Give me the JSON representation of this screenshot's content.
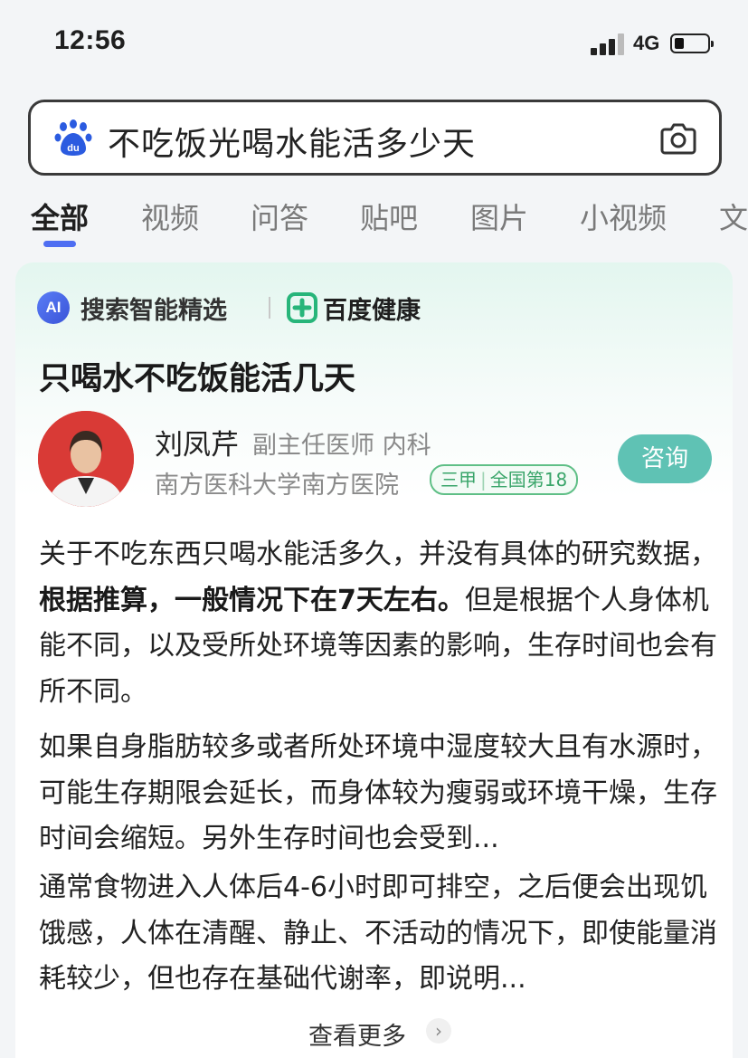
{
  "status_bar": {
    "time": "12:56",
    "network": "4G"
  },
  "search": {
    "query": "不吃饭光喝水能活多少天"
  },
  "tabs": [
    {
      "label": "全部",
      "active": true
    },
    {
      "label": "视频"
    },
    {
      "label": "问答"
    },
    {
      "label": "贴吧"
    },
    {
      "label": "图片"
    },
    {
      "label": "小视频"
    },
    {
      "label": "文"
    }
  ],
  "card": {
    "ai_badge": "AI",
    "ai_label": "搜索智能精选",
    "health_label": "百度健康",
    "title": "只喝水不吃饭能活几天",
    "doctor": {
      "name": "刘凤芹",
      "title": "副主任医师 内科",
      "hospital": "南方医科大学南方医院",
      "grade": "三甲",
      "rank": "全国第18",
      "consult_label": "咨询"
    },
    "paragraph1": {
      "before": "关于不吃东西只喝水能活多久，并没有具体的研究数据，",
      "bold": "根据推算，一般情况下在7天左右。",
      "after": "但是根据个人身体机能不同，以及受所处环境等因素的影响，生存时间也会有所不同。"
    },
    "paragraph2": "如果自身脂肪较多或者所处环境中湿度较大且有水源时，可能生存期限会延长，而身体较为瘦弱或环境干燥，生存时间会缩短。另外生存时间也会受到...",
    "paragraph3": "通常食物进入人体后4-6小时即可排空，之后便会出现饥饿感，人体在清醒、静止、不活动的情况下，即使能量消耗较少，但也存在基础代谢率，即说明...",
    "more_label": "查看更多"
  },
  "colors": {
    "accent": "#4e6ef2",
    "consult": "#5fc2b4",
    "badge_green": "#3aa56a",
    "avatar_bg": "#d93a36"
  },
  "icons": [
    "baidu-paw-icon",
    "camera-icon",
    "ai-badge-icon",
    "health-cross-icon",
    "chevron-right-icon",
    "signal-icon",
    "battery-icon"
  ]
}
